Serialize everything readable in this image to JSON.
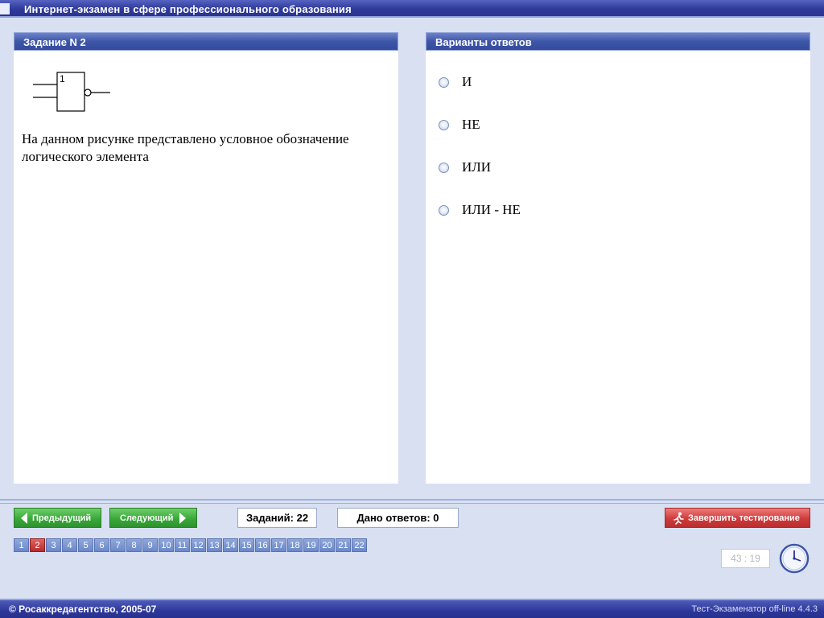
{
  "window": {
    "title": "Интернет-экзамен в сфере профессионального образования"
  },
  "task": {
    "header": "Задание N 2",
    "diagram_label": "1",
    "question": "На данном рисунке представлено условное обозначение логического элемента"
  },
  "answers": {
    "header": "Варианты ответов",
    "options": [
      "И",
      "НЕ",
      "ИЛИ",
      "ИЛИ - НЕ"
    ],
    "selected": null
  },
  "nav": {
    "prev_label": "Предыдущий",
    "next_label": "Следующий",
    "tasks_count_label": "Заданий: 22",
    "answers_given_label": "Дано ответов: 0",
    "finish_label": "Завершить тестирование"
  },
  "pager": {
    "pages": [
      "1",
      "2",
      "3",
      "4",
      "5",
      "6",
      "7",
      "8",
      "9",
      "10",
      "11",
      "12",
      "13",
      "14",
      "15",
      "16",
      "17",
      "18",
      "19",
      "20",
      "21",
      "22"
    ],
    "current": "2"
  },
  "timer": {
    "value": "43 : 19"
  },
  "footer": {
    "copyright": "© Росаккредагентство, 2005-07",
    "version": "Тест-Экзаменатор off-line 4.4.3"
  },
  "colors": {
    "title_bar": "#2f3a9a",
    "panel_header": "#3e56a8",
    "nav_button": "#3aa83a",
    "finish_button": "#cf3b3b",
    "active_page": "#b92c2c"
  },
  "icons": {
    "prev": "arrow-left-icon",
    "next": "arrow-right-icon",
    "finish": "running-man-icon",
    "timer": "clock-icon"
  }
}
